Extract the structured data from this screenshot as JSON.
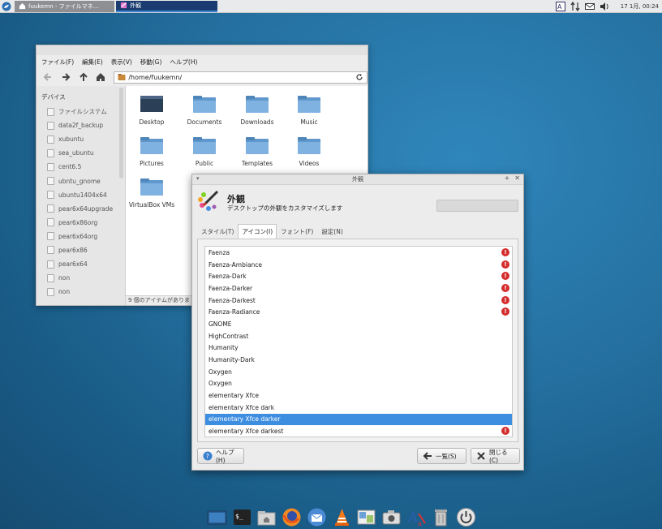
{
  "top_panel": {
    "tasks": [
      {
        "label": "fuukemn - ファイルマネ…",
        "active": false
      },
      {
        "label": "外観",
        "active": true
      }
    ],
    "clock": "17 1月, 00:24"
  },
  "file_manager": {
    "menu": [
      "ファイル(F)",
      "編集(E)",
      "表示(V)",
      "移動(G)",
      "ヘルプ(H)"
    ],
    "location": "/home/fuukemn/",
    "sidebar_section": "デバイス",
    "devices": [
      "ファイルシステム",
      "data2f_backup",
      "xubuntu",
      "sea_ubuntu",
      "cent6.5",
      "ubntu_gnome",
      "ubuntu1404x64",
      "pear6x64upgrade",
      "pear6x86org",
      "pear6x64org",
      "pear6x86",
      "pear6x64",
      "non",
      "non"
    ],
    "folders": [
      "Desktop",
      "Documents",
      "Downloads",
      "Music",
      "Pictures",
      "Public",
      "Templates",
      "Videos",
      "VirtualBox VMs"
    ],
    "status": "9 個のアイテムがありま"
  },
  "dialog": {
    "title": "外観",
    "heading": "外観",
    "subtitle": "デスクトップの外観をカスタマイズします",
    "tabs": [
      "スタイル(T)",
      "アイコン(I)",
      "フォント(F)",
      "設定(N)"
    ],
    "active_tab": "アイコン(I)",
    "themes": [
      {
        "name": "Faenza",
        "warning": true
      },
      {
        "name": "Faenza-Ambiance",
        "warning": true
      },
      {
        "name": "Faenza-Dark",
        "warning": true
      },
      {
        "name": "Faenza-Darker",
        "warning": true
      },
      {
        "name": "Faenza-Darkest",
        "warning": true
      },
      {
        "name": "Faenza-Radiance",
        "warning": true
      },
      {
        "name": "GNOME",
        "warning": false
      },
      {
        "name": "HighContrast",
        "warning": false
      },
      {
        "name": "Humanity",
        "warning": false
      },
      {
        "name": "Humanity-Dark",
        "warning": false
      },
      {
        "name": "Oxygen",
        "warning": false
      },
      {
        "name": "Oxygen",
        "warning": false
      },
      {
        "name": "elementary Xfce",
        "warning": false
      },
      {
        "name": "elementary Xfce dark",
        "warning": false
      },
      {
        "name": "elementary Xfce darker",
        "warning": false,
        "selected": true
      },
      {
        "name": "elementary Xfce darkest",
        "warning": true
      }
    ],
    "buttons": {
      "help": "ヘルプ(H)",
      "all": "一覧(S)",
      "close": "閉じる(C)"
    }
  },
  "dock": [
    "show-desktop-icon",
    "terminal-icon",
    "file-manager-icon",
    "firefox-icon",
    "thunderbird-icon",
    "vlc-icon",
    "image-viewer-icon",
    "screenshot-icon",
    "font-icon",
    "trash-icon",
    "power-icon"
  ],
  "colors": {
    "selection": "#3d8de0",
    "warning": "#d42d2d",
    "active_task": "#1a3c70"
  }
}
